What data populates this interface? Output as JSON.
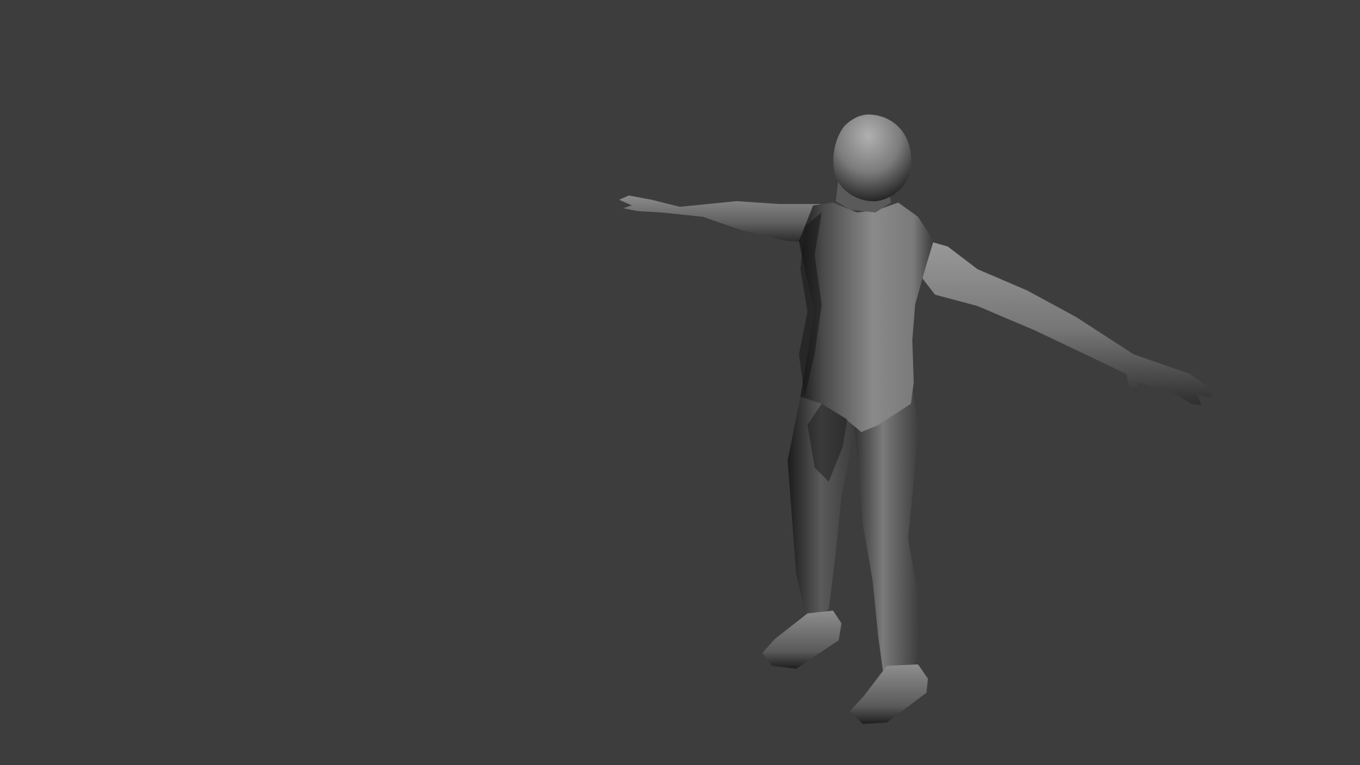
{
  "viewport": {
    "background_color": "#3d3d3d",
    "subject": "mannequin-model",
    "pose": "T-pose",
    "shading": "smooth-gray",
    "body_colors": {
      "highlight": "#9a9a9a",
      "mid": "#7a7a7a",
      "shadow": "#3a3a3a",
      "deep_shadow": "#141414"
    }
  }
}
